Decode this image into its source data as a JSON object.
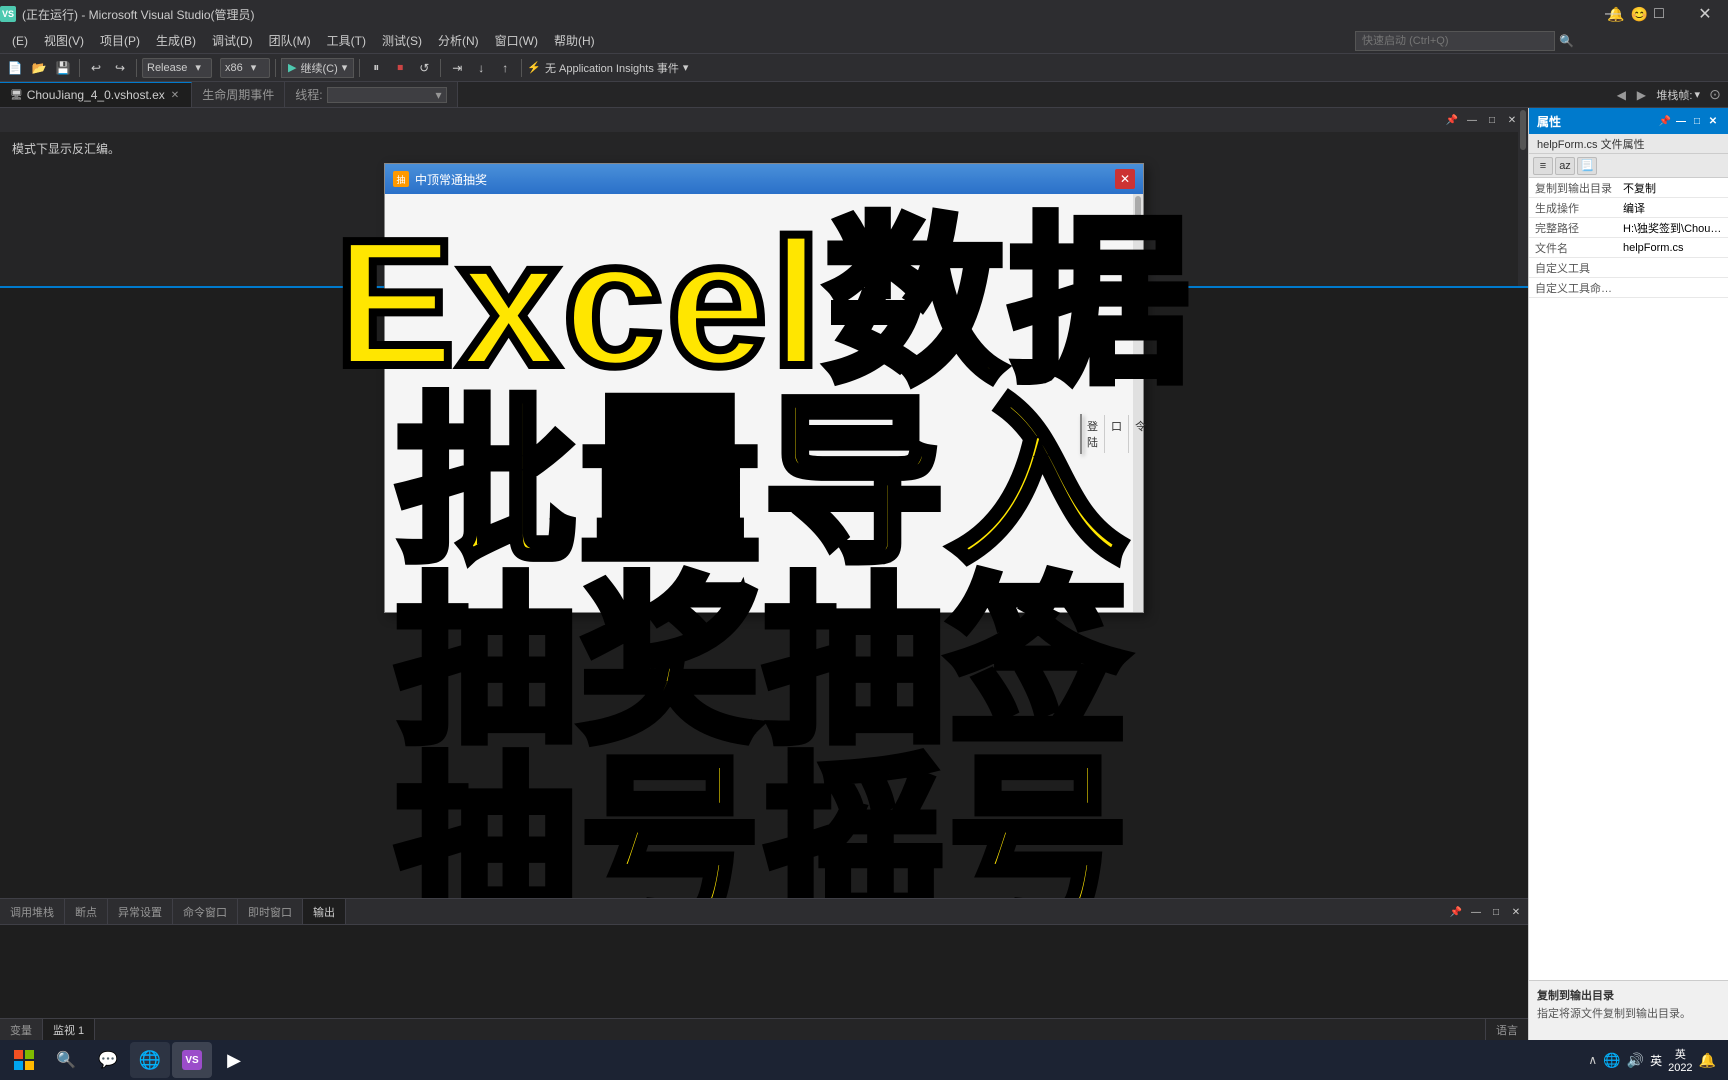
{
  "window": {
    "title": "(正在运行) - Microsoft Visual Studio(管理员)",
    "icon": "VS"
  },
  "title_bar": {
    "title": "(正在运行) - Microsoft Visual Studio(管理员)",
    "minimize_label": "—",
    "maximize_label": "□",
    "close_label": "✕"
  },
  "menu": {
    "items": [
      "(E)",
      "视图(V)",
      "项目(P)",
      "生成(B)",
      "调试(D)",
      "团队(M)",
      "工具(T)",
      "测试(S)",
      "分析(N)",
      "窗口(W)",
      "帮助(H)"
    ]
  },
  "toolbar": {
    "config": "Release",
    "platform": "x86",
    "start_label": "继续(C)",
    "insights_label": "无 Application Insights 事件",
    "quick_search_placeholder": "快速启动 (Ctrl+Q)"
  },
  "tabs": {
    "active_tab": "ChouJiang_4_0.vshost.ex",
    "items": [
      "ChouJiang_4_0.vshost.ex",
      "生命周期事件",
      "线程:"
    ]
  },
  "editor": {
    "note": "模式下显示反汇编。"
  },
  "dialog": {
    "title": "中顶常通抽奖",
    "icon_label": "抽",
    "floating_tools": [
      "登陆",
      "口",
      "令"
    ]
  },
  "overlay": {
    "line1": "Excel数据",
    "line2": "批量导入",
    "line3": "抽奖抽签",
    "line4": "抽号摇号"
  },
  "properties_panel": {
    "title": "属性",
    "subtitle": "helpForm.cs 文件属性",
    "properties": [
      {
        "name": "复制到输出目录",
        "value": "不复制"
      },
      {
        "name": "生成操作",
        "value": "编译"
      },
      {
        "name": "完整路径",
        "value": "H:\\独奖签到\\Chou江..."
      },
      {
        "name": "文件名",
        "value": "helpForm.cs"
      },
      {
        "name": "自定义工具",
        "value": ""
      },
      {
        "name": "自定义工具命名空间",
        "value": ""
      }
    ],
    "footer_text": "复制到输出目录",
    "footer_desc": "指定将源文件复制到输出目录。"
  },
  "debug_panel": {
    "tabs": [
      "调用堆栈",
      "断点",
      "异常设置",
      "命令窗口",
      "即时窗口",
      "输出"
    ],
    "active_tab": "输出"
  },
  "status_bar": {
    "mode": "语言",
    "items": [
      "变量 监视 1",
      "语言"
    ]
  },
  "taskbar": {
    "time": "2022",
    "lang": "英",
    "apps": [
      "⊞",
      "🔍",
      "💬"
    ]
  },
  "top_right_sys": {
    "icon1": "🔔",
    "icon2": "😊"
  }
}
